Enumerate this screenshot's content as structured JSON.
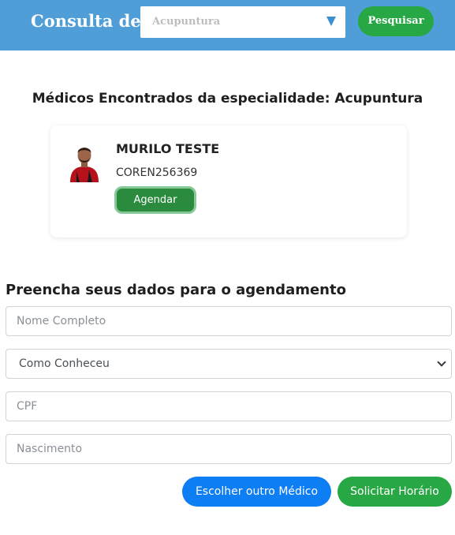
{
  "header": {
    "brand": "Consulta de",
    "specialty_selected": "Acupuntura",
    "search_label": "Pesquisar"
  },
  "results": {
    "title": "Médicos Encontrados da especialidade: Acupuntura",
    "doctor": {
      "name": "MURILO TESTE",
      "registration": "COREN256369",
      "schedule_label": "Agendar"
    }
  },
  "form": {
    "title": "Preencha seus dados para o agendamento",
    "name_placeholder": "Nome Completo",
    "referral_selected": "Como Conheceu",
    "cpf_placeholder": "CPF",
    "birth_placeholder": "Nascimento"
  },
  "actions": {
    "choose_other_label": "Escolher outro Médico",
    "request_label": "Solicitar Horário"
  },
  "colors": {
    "header_bg": "#4f9ed8",
    "success": "#28a745",
    "primary": "#0d7ef3"
  }
}
